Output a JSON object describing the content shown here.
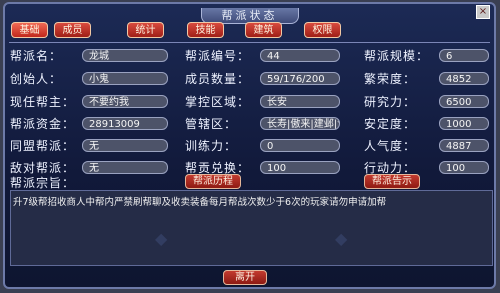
{
  "window": {
    "title": "帮派状态",
    "close_glyph": "×"
  },
  "tabs": [
    "基础",
    "成员",
    "统计",
    "技能",
    "建筑",
    "权限"
  ],
  "left": [
    {
      "label": "帮派名：",
      "value": "龙城"
    },
    {
      "label": "创始人：",
      "value": "小鬼"
    },
    {
      "label": "现任帮主：",
      "value": "不要约我"
    },
    {
      "label": "帮派资金：",
      "value": "28913009"
    },
    {
      "label": "同盟帮派：",
      "value": "无"
    },
    {
      "label": "敌对帮派：",
      "value": "无"
    }
  ],
  "middle": [
    {
      "label": "帮派编号：",
      "value": "44"
    },
    {
      "label": "成员数量：",
      "value": "59/176/200"
    },
    {
      "label": "掌控区域：",
      "value": "长安"
    },
    {
      "label": "管辖区：",
      "value": "长寿|傲来|建邺|江南"
    },
    {
      "label": "训练力：",
      "value": "0"
    },
    {
      "label": "帮贡兑换：",
      "value": "100"
    }
  ],
  "right": [
    {
      "label": "帮派规模：",
      "value": "6"
    },
    {
      "label": "繁荣度：",
      "value": "4852"
    },
    {
      "label": "研究力：",
      "value": "6500"
    },
    {
      "label": "安定度：",
      "value": "1000"
    },
    {
      "label": "人气度：",
      "value": "4887"
    },
    {
      "label": "行动力：",
      "value": "100"
    }
  ],
  "purpose_label": "帮派宗旨：",
  "history_button": "帮派历程",
  "notice_button": "帮派告示",
  "purpose_text": "升7级帮招收商人中帮内严禁刷帮聊及收卖装备每月帮战次数少于6次的玩家请勿申请加帮",
  "leave_button": "离开",
  "colors": {
    "tab_red": "#b8281c",
    "panel_blue": "#13204a",
    "field_gray": "#4d5369"
  }
}
